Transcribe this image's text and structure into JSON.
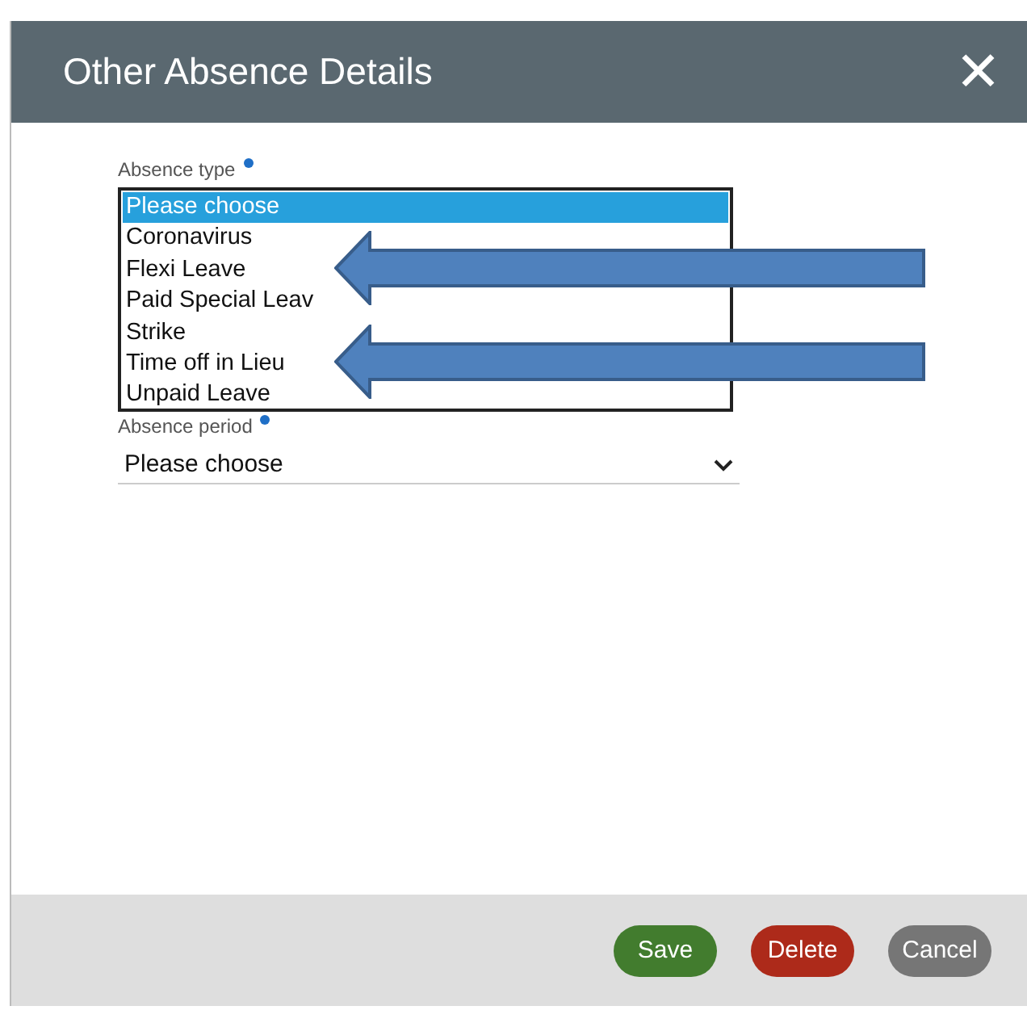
{
  "dialog": {
    "title": "Other Absence Details",
    "close": "✕"
  },
  "absence_type": {
    "label": "Absence type",
    "required": true,
    "options": [
      {
        "label": "Please choose",
        "selected": true
      },
      {
        "label": "Coronavirus",
        "selected": false
      },
      {
        "label": "Flexi Leave",
        "selected": false
      },
      {
        "label": "Paid Special Leav",
        "selected": false
      },
      {
        "label": "Strike",
        "selected": false
      },
      {
        "label": "Time off in Lieu",
        "selected": false
      },
      {
        "label": "Unpaid Leave",
        "selected": false
      }
    ]
  },
  "absence_period": {
    "label": "Absence period",
    "required": true,
    "value": "Please choose"
  },
  "annotations": [
    {
      "kind": "arrow"
    },
    {
      "kind": "arrow"
    }
  ],
  "buttons": [
    {
      "label": "Save",
      "kind": "primary"
    },
    {
      "label": "Delete",
      "kind": "danger"
    },
    {
      "label": "Cancel",
      "kind": "neutral"
    }
  ]
}
